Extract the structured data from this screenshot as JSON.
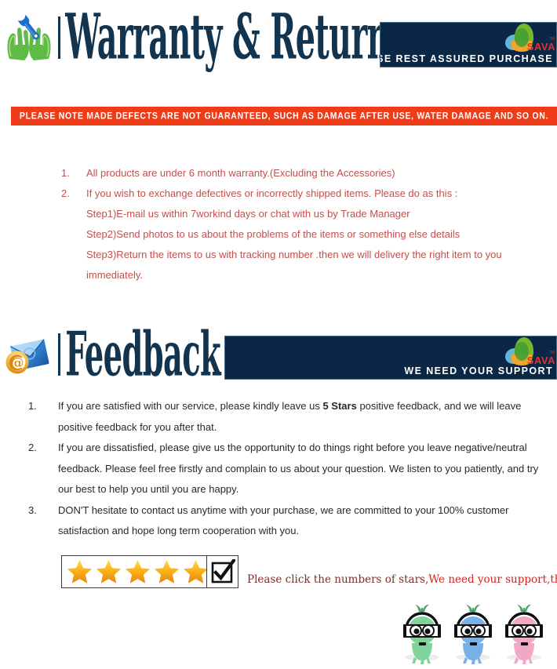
{
  "theme": {
    "navy": "#0a2746",
    "title_navy": "#13344f",
    "warning_red": "#ef3c18",
    "warranty_text": "#c0504d",
    "feedback_text": "#282828",
    "star_gold": "#f5a623",
    "caption_dark_red": "#7b2f2a",
    "caption_bright_red": "#d8221f",
    "logo_word_red": "#e8312a"
  },
  "warranty_section": {
    "icon_name": "hands-holding-wrench-icon",
    "title": "Warranty & Return",
    "banner": {
      "text": "PLEASE  REST  ASSURED  PURCHASE",
      "logo_word": "SAVA",
      "logo_tm": "TM"
    },
    "warning_strip": "PLEASE NOTE MADE DEFECTS ARE NOT GUARANTEED,  SUCH AS DAMAGE AFTER USE,  WATER DAMAGE AND SO ON.",
    "items": [
      {
        "number": "1.",
        "text": "All products are under 6 month warranty.(Excluding the Accessories)",
        "sublines": []
      },
      {
        "number": "2.",
        "text": "If you wish to exchange defectives or incorrectly shipped items. Please do as this :",
        "sublines": [
          "Step1)E-mail us within 7workind days or chat with us by Trade Manager",
          "Step2)Send photos to us about the problems of the items or something  else details",
          "Step3)Return the items to us with tracking number .then we will delivery the right item to you",
          "immediately."
        ]
      }
    ]
  },
  "feedback_section": {
    "icon_name": "email-at-envelope-icon",
    "title": "Feedback",
    "banner": {
      "text": "WE  NEED  YOUR  SUPPORT",
      "logo_word": "SAVA",
      "logo_tm": "TM"
    },
    "items": [
      {
        "number": "1.",
        "lines": [
          {
            "pre": "If you are satisfied with our service, please kindly leave us ",
            "bold": "5 Stars",
            "post": " positive feedback, and we will leave"
          },
          {
            "pre": "positive feedback for you after that.",
            "bold": "",
            "post": ""
          }
        ]
      },
      {
        "number": "2.",
        "lines": [
          {
            "pre": "If you are dissatisfied, please give us the opportunity to do things right before you leave negative/neutral",
            "bold": "",
            "post": ""
          },
          {
            "pre": "feedback. Please feel free firstly and complain to us about your question. We listen to you patiently, and try",
            "bold": "",
            "post": ""
          },
          {
            "pre": "our best to help you until you are happy.",
            "bold": "",
            "post": ""
          }
        ]
      },
      {
        "number": "3.",
        "lines": [
          {
            "pre": "DON'T hesitate to contact us anytime with your purchase, we are committed to your 100% customer",
            "bold": "",
            "post": ""
          },
          {
            "pre": "satisfaction and hope long term cooperation with you.",
            "bold": "",
            "post": ""
          }
        ]
      }
    ],
    "rating_widget": {
      "star_count": 5,
      "checkbox_checked": true,
      "caption_dark": "Please click the numbers of stars,",
      "caption_bright": "We need your support,thank you!"
    },
    "mascots": [
      {
        "name": "mascot-green",
        "color": "#7ed49a",
        "dark": "#4aa86d"
      },
      {
        "name": "mascot-blue",
        "color": "#7ab0e8",
        "dark": "#4a82c4"
      },
      {
        "name": "mascot-pink",
        "color": "#f0a8c4",
        "dark": "#d4709c"
      }
    ]
  }
}
